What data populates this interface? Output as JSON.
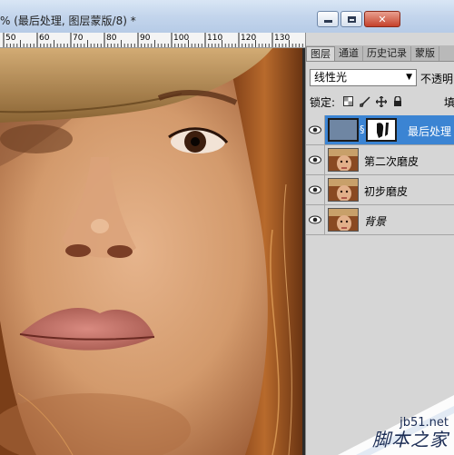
{
  "window": {
    "title": "% (最后处理, 图层蒙版/8) *",
    "min_button": "minimize",
    "max_button": "maximize",
    "close_button": "x"
  },
  "ruler": {
    "labels": [
      "50",
      "60",
      "70",
      "80",
      "90",
      "100",
      "110",
      "120",
      "130"
    ]
  },
  "panel": {
    "tabs": [
      "图层",
      "通道",
      "历史记录",
      "蒙版"
    ],
    "active_tab": "图层",
    "blend_mode": "线性光",
    "opacity_label": "不透明",
    "lock_label": "锁定:",
    "fill_label": "填",
    "layers": [
      {
        "name": "最后处理",
        "selected": true,
        "has_mask": true
      },
      {
        "name": "第二次磨皮",
        "selected": false
      },
      {
        "name": "初步磨皮",
        "selected": false
      },
      {
        "name": "背景",
        "selected": false,
        "italic": true
      }
    ]
  },
  "watermark": {
    "site": "jb51.net",
    "name": "脚本之家"
  },
  "colors": {
    "selection": "#3b84d3",
    "panel_bg": "#d6d6d6",
    "titlebar": "#c3d5ec"
  }
}
